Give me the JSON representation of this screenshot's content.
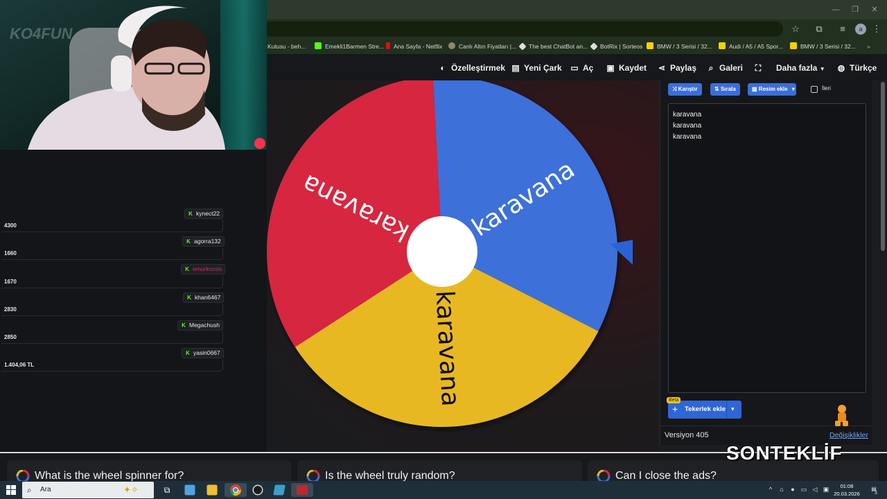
{
  "browser": {
    "bookmarks": [
      {
        "label": "Kutusu - beh...",
        "color": "#3a3a3a"
      },
      {
        "label": "Emekli1Barmen Stre...",
        "color": "#53fc18"
      },
      {
        "label": "Ana Sayfa - Netflix",
        "color": "#e50914"
      },
      {
        "label": "Canlı Altın Fiyatları |...",
        "color": "#8a8a6a"
      },
      {
        "label": "The best ChatBot an...",
        "color": "#dddddd"
      },
      {
        "label": "BotRix | Sorteos",
        "color": "#dddddd"
      },
      {
        "label": "BMW / 3 Serisi / 32...",
        "color": "#f5d300"
      },
      {
        "label": "Audi / A5 / A5 Spor...",
        "color": "#f5d300"
      },
      {
        "label": "BMW / 3 Serisi / 32...",
        "color": "#f5d300"
      }
    ],
    "profile_initial": "a"
  },
  "nav": {
    "customize": "Özelleştirmek",
    "new_wheel": "Yeni Çark",
    "open": "Aç",
    "save": "Kaydet",
    "share": "Paylaş",
    "gallery": "Galeri",
    "more": "Daha fazla",
    "language": "Türkçe"
  },
  "wheel": {
    "segments": [
      {
        "label": "karavana",
        "color": "#3e6fd9"
      },
      {
        "label": "karavana",
        "color": "#e8b824"
      },
      {
        "label": "karavana",
        "color": "#d7283f"
      }
    ],
    "pointer_color": "#2a62d6"
  },
  "panel": {
    "shuffle": "Karıştır",
    "sort": "Sırala",
    "add_image": "Resim ekle",
    "advanced": "İleri",
    "entries": [
      "karavana",
      "karavana",
      "karavana"
    ],
    "add_wheel": "Tekerlek ekle",
    "beta": "Beta",
    "version": "Versiyon 405",
    "changes": "Değişiklikler"
  },
  "overlay": {
    "webcam_watermark": "KO4FUN",
    "viewers": [
      {
        "name": "kynect22",
        "amount": "4300",
        "name_color": "#e8e8e8"
      },
      {
        "name": "agorra132",
        "amount": "1660",
        "name_color": "#e8e8e8"
      },
      {
        "name": "emurkocoo",
        "amount": "1670",
        "name_color": "#e0245e"
      },
      {
        "name": "khan6467",
        "amount": "2830",
        "name_color": "#e8e8e8"
      },
      {
        "name": "Megachush",
        "amount": "2850",
        "name_color": "#e8e8e8"
      },
      {
        "name": "yasin0667",
        "amount": "1.404,06 TL",
        "name_color": "#e8e8e8"
      }
    ]
  },
  "faq": [
    "What is the wheel spinner for?",
    "Is the wheel truly random?",
    "Can I close the ads?"
  ],
  "brand": "SONTEKLİF",
  "taskbar": {
    "search": "Ara",
    "time": "01:08",
    "date": "20.03.2026",
    "notifications": "3"
  }
}
